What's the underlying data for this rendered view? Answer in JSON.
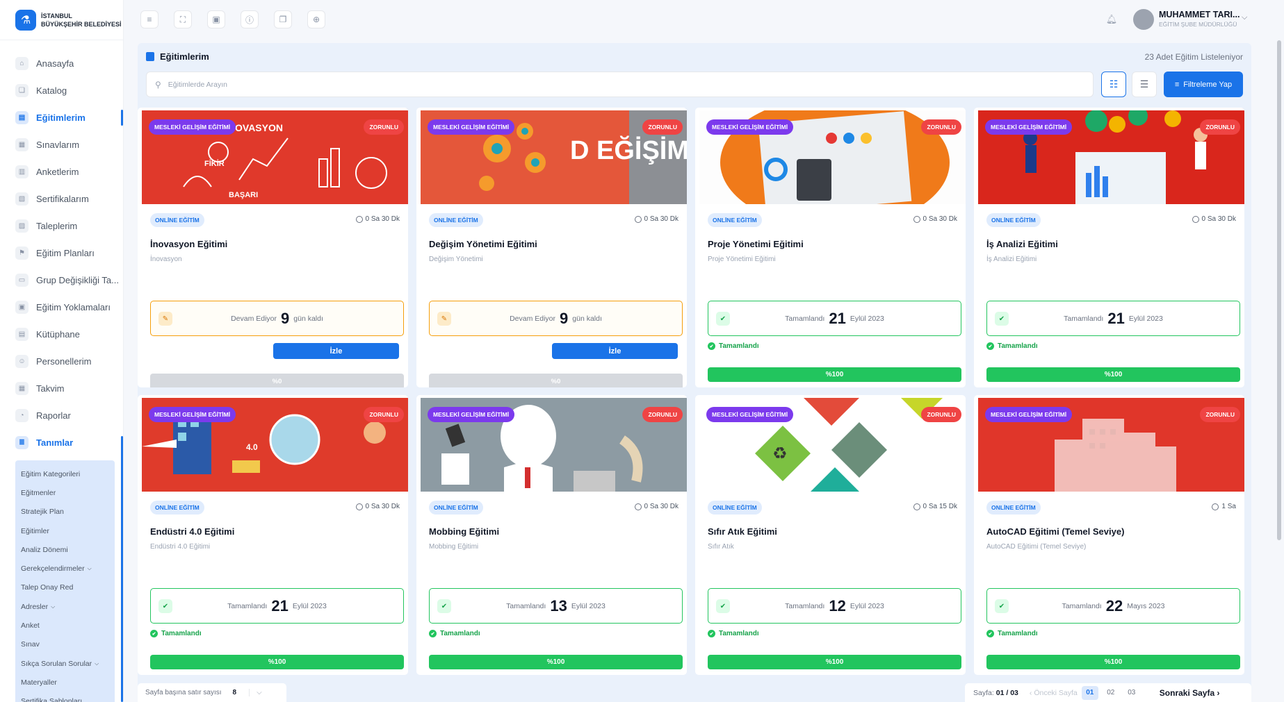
{
  "org": {
    "line1": "İSTANBUL",
    "line2": "BÜYÜKŞEHİR BELEDİYESİ"
  },
  "sidebar": {
    "items": [
      {
        "label": "Anasayfa",
        "icon": "home-icon"
      },
      {
        "label": "Katalog",
        "icon": "catalog-icon"
      },
      {
        "label": "Eğitimlerim",
        "icon": "book-icon",
        "active": true
      },
      {
        "label": "Sınavlarım",
        "icon": "exam-icon"
      },
      {
        "label": "Anketlerim",
        "icon": "survey-icon"
      },
      {
        "label": "Sertifikalarım",
        "icon": "certificate-icon"
      },
      {
        "label": "Taleplerim",
        "icon": "request-icon"
      },
      {
        "label": "Eğitim Planları",
        "icon": "plan-icon"
      },
      {
        "label": "Grup Değişikliği Ta...",
        "icon": "group-change-icon"
      },
      {
        "label": "Eğitim Yoklamaları",
        "icon": "attendance-icon"
      },
      {
        "label": "Kütüphane",
        "icon": "library-icon"
      },
      {
        "label": "Personellerim",
        "icon": "people-icon"
      },
      {
        "label": "Takvim",
        "icon": "calendar-icon"
      },
      {
        "label": "Raporlar",
        "icon": "report-icon"
      },
      {
        "label": "Tanımlar",
        "icon": "definitions-icon",
        "active": true
      }
    ],
    "subitems": [
      "Eğitim Kategorileri",
      "Eğitmenler",
      "Stratejik Plan",
      "Eğitimler",
      "Analiz Dönemi",
      "Gerekçelendirmeler",
      "Talep Onay Red",
      "Adresler",
      "Anket",
      "Sınav",
      "Sıkça Sorulan Sorular",
      "Materyaller",
      "Sertifika Şablonları"
    ]
  },
  "user": {
    "name": "MUHAMMET TARI...",
    "dept": "EĞİTİM ŞUBE MÜDÜRLÜĞÜ"
  },
  "page": {
    "title": "Eğitimlerim",
    "count": "23 Adet Eğitim Listeleniyor",
    "search_placeholder": "Eğitimlerde Arayın",
    "filter_label": "Filtreleme Yap"
  },
  "cards": [
    {
      "category": "MESLEKİ GELİŞİM EĞİTİMİ",
      "required": "ZORUNLU",
      "type": "ONLİNE EĞİTİM",
      "duration": "0 Sa 30 Dk",
      "title": "İnovasyon Eğitimi",
      "subtitle": "İnovasyon",
      "status_label": "Devam Ediyor",
      "status_num": "9",
      "status_suffix": "gün kaldı",
      "watch": "İzle",
      "progress": "%0",
      "img_text": "İNOVASYON"
    },
    {
      "category": "MESLEKİ GELİŞİM EĞİTİMİ",
      "required": "ZORUNLU",
      "type": "ONLİNE EĞİTİM",
      "duration": "0 Sa 30 Dk",
      "title": "Değişim Yönetimi Eğitimi",
      "subtitle": "Değişim Yönetimi",
      "status_label": "Devam Ediyor",
      "status_num": "9",
      "status_suffix": "gün kaldı",
      "watch": "İzle",
      "progress": "%0",
      "img_text": "D EĞİŞİM"
    },
    {
      "category": "MESLEKİ GELİŞİM EĞİTİMİ",
      "required": "ZORUNLU",
      "type": "ONLİNE EĞİTİM",
      "duration": "0 Sa 30 Dk",
      "title": "Proje Yönetimi Eğitimi",
      "subtitle": "Proje Yönetimi Eğitimi",
      "status_label": "Tamamlandı",
      "status_num": "21",
      "status_suffix": "Eylül 2023",
      "done": "Tamamlandı",
      "progress": "%100"
    },
    {
      "category": "MESLEKİ GELİŞİM EĞİTİMİ",
      "required": "ZORUNLU",
      "type": "ONLİNE EĞİTİM",
      "duration": "0 Sa 30 Dk",
      "title": "İş Analizi Eğitimi",
      "subtitle": "İş Analizi Eğitimi",
      "status_label": "Tamamlandı",
      "status_num": "21",
      "status_suffix": "Eylül 2023",
      "done": "Tamamlandı",
      "progress": "%100"
    },
    {
      "category": "MESLEKİ GELİŞİM EĞİTİMİ",
      "required": "ZORUNLU",
      "type": "ONLİNE EĞİTİM",
      "duration": "0 Sa 30 Dk",
      "title": "Endüstri 4.0 Eğitimi",
      "subtitle": "Endüstri 4.0 Eğitimi",
      "status_label": "Tamamlandı",
      "status_num": "21",
      "status_suffix": "Eylül 2023",
      "done": "Tamamlandı",
      "progress": "%100"
    },
    {
      "category": "MESLEKİ GELİŞİM EĞİTİMİ",
      "required": "ZORUNLU",
      "type": "ONLİNE EĞİTİM",
      "duration": "0 Sa 30 Dk",
      "title": "Mobbing Eğitimi",
      "subtitle": "Mobbing Eğitimi",
      "status_label": "Tamamlandı",
      "status_num": "13",
      "status_suffix": "Eylül 2023",
      "done": "Tamamlandı",
      "progress": "%100"
    },
    {
      "category": "MESLEKİ GELİŞİM EĞİTİMİ",
      "required": "ZORUNLU",
      "type": "ONLİNE EĞİTİM",
      "duration": "0 Sa 15 Dk",
      "title": "Sıfır Atık Eğitimi",
      "subtitle": "Sıfır Atık",
      "status_label": "Tamamlandı",
      "status_num": "12",
      "status_suffix": "Eylül 2023",
      "done": "Tamamlandı",
      "progress": "%100"
    },
    {
      "category": "MESLEKİ GELİŞİM EĞİTİMİ",
      "required": "ZORUNLU",
      "type": "ONLİNE EĞİTİM",
      "duration": "1 Sa",
      "title": "AutoCAD Eğitimi (Temel Seviye)",
      "subtitle": "AutoCAD Eğitimi (Temel Seviye)",
      "status_label": "Tamamlandı",
      "status_num": "22",
      "status_suffix": "Mayıs 2023",
      "done": "Tamamlandı",
      "progress": "%100"
    }
  ],
  "pager": {
    "rows_label": "Sayfa başına satır sayısı",
    "rows_value": "8",
    "page_label": "Sayfa:",
    "page_value": "01 / 03",
    "prev": "‹ Önceki Sayfa",
    "pages": [
      "01",
      "02",
      "03"
    ],
    "next": "Sonraki Sayfa ›"
  }
}
